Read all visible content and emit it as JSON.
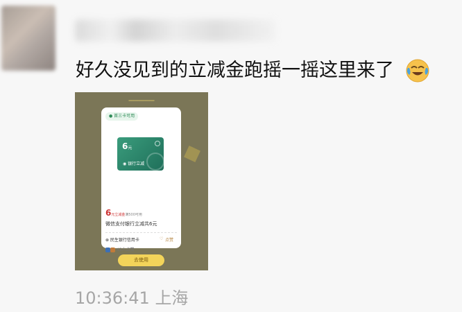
{
  "post": {
    "text": "好久没见到的立减金跑摇一摇这里来了",
    "emoji": "face-with-tears-of-joy-icon",
    "timestamp": "10:36:41",
    "location": "上海"
  },
  "image": {
    "card_badge": "● 首三卡可用",
    "coupon_amount": "6",
    "coupon_unit": "元",
    "coupon_bank": "◉ 银行立减",
    "amount_big": "6",
    "amount_suffix": "元立减金",
    "amount_condition": "满500可用",
    "description": "微信支付银行立减共6元",
    "bank_name": "⊗ 民生银行信用卡",
    "like_label": "点赞",
    "users_label": "43人点赞",
    "use_button": "去使用"
  },
  "colors": {
    "coupon_green": "#2a8a6c",
    "button_yellow": "#f3d45a",
    "image_bg": "#7b7657"
  }
}
